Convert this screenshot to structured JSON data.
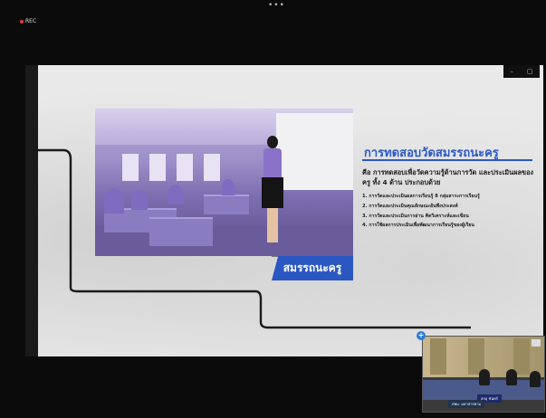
{
  "recording": {
    "label": "REC"
  },
  "toolbar": {
    "more_label": "•••"
  },
  "window_controls": {
    "minimize": "–",
    "restore": "▢"
  },
  "slide": {
    "title": "การทดสอบวัดสมรรถนะครู",
    "definition": "คือ การทดสอบเพื่อวัดความรู้ด้านการวัด และประเมินผลของครู ทั้ง 4 ด้าน ประกอบด้วย",
    "items": [
      "1. การวัดและประเมินผลการเรียนรู้ 8 กลุ่มสาระการเรียนรู้",
      "2. การวัดและประเมินคุณลักษณะอันพึงประสงค์",
      "3. การวัดและประเมินการอ่าน คิดวิเคราะห์และเขียน",
      "4. การใช้ผลการประเมินเพื่อพัฒนาการเรียนรู้ของผู้เรียน"
    ],
    "badge": "สมรรถนะครู",
    "colors": {
      "accent": "#2c59c4",
      "badge_bg": "#2a57c2"
    }
  },
  "pip": {
    "plus_label": "+",
    "name_caption": "สกลุ ขันทร์",
    "school_caption": "สพม. มหาสารคาม"
  }
}
